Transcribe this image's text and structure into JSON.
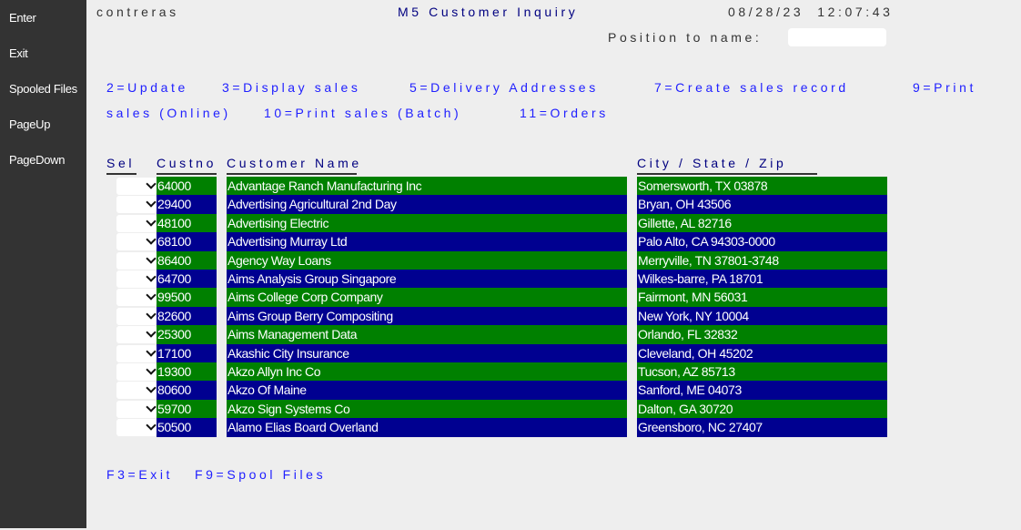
{
  "sidebar": {
    "items": [
      {
        "label": "Enter"
      },
      {
        "label": "Exit"
      },
      {
        "label": "Spooled Files"
      },
      {
        "label": "PageUp"
      },
      {
        "label": "PageDown"
      }
    ]
  },
  "header": {
    "user": "contreras",
    "title": "M5 Customer Inquiry",
    "datetime": "08/28/23  12:07:43",
    "position_label": "Position to name:",
    "position_value": "",
    "position_placeholder": ""
  },
  "options": {
    "line1": [
      {
        "label": "2=Update"
      },
      {
        "label": "3=Display sales"
      },
      {
        "label": "5=Delivery Addresses"
      },
      {
        "label": "7=Create sales record"
      },
      {
        "label": "9=Print"
      }
    ],
    "line2": [
      {
        "label": "sales (Online)"
      },
      {
        "label": "10=Print sales (Batch)"
      },
      {
        "label": "11=Orders"
      }
    ]
  },
  "table": {
    "columns": {
      "sel": "Sel",
      "custno": "Custno",
      "name": "Customer Name",
      "city": "City / State / Zip"
    },
    "row_colors": {
      "even": "#008000",
      "odd": "#000090"
    },
    "rows": [
      {
        "sel": "",
        "custno": "64000",
        "name": "Advantage Ranch Manufacturing Inc",
        "city": "Somersworth, TX 03878"
      },
      {
        "sel": "",
        "custno": "29400",
        "name": "Advertising Agricultural 2nd Day",
        "city": "Bryan, OH 43506"
      },
      {
        "sel": "",
        "custno": "48100",
        "name": "Advertising Electric",
        "city": "Gillette, AL 82716"
      },
      {
        "sel": "",
        "custno": "68100",
        "name": "Advertising Murray Ltd",
        "city": "Palo Alto, CA 94303-0000"
      },
      {
        "sel": "",
        "custno": "86400",
        "name": "Agency Way Loans",
        "city": "Merryville, TN 37801-3748"
      },
      {
        "sel": "",
        "custno": "64700",
        "name": "Aims Analysis Group Singapore",
        "city": "Wilkes-barre, PA 18701"
      },
      {
        "sel": "",
        "custno": "99500",
        "name": "Aims College Corp Company",
        "city": "Fairmont, MN 56031"
      },
      {
        "sel": "",
        "custno": "82600",
        "name": "Aims Group Berry Compositing",
        "city": "New York, NY 10004"
      },
      {
        "sel": "",
        "custno": "25300",
        "name": "Aims Management Data",
        "city": "Orlando, FL 32832"
      },
      {
        "sel": "",
        "custno": "17100",
        "name": "Akashic City Insurance",
        "city": "Cleveland, OH 45202"
      },
      {
        "sel": "",
        "custno": "19300",
        "name": "Akzo Allyn Inc Co",
        "city": "Tucson, AZ 85713"
      },
      {
        "sel": "",
        "custno": "80600",
        "name": "Akzo Of Maine",
        "city": "Sanford, ME 04073"
      },
      {
        "sel": "",
        "custno": "59700",
        "name": "Akzo Sign Systems Co",
        "city": "Dalton, GA 30720"
      },
      {
        "sel": "",
        "custno": "50500",
        "name": "Alamo Elias Board Overland",
        "city": "Greensboro, NC 27407"
      }
    ]
  },
  "fkeys": [
    {
      "label": "F3=Exit"
    },
    {
      "label": "F9=Spool Files"
    }
  ]
}
